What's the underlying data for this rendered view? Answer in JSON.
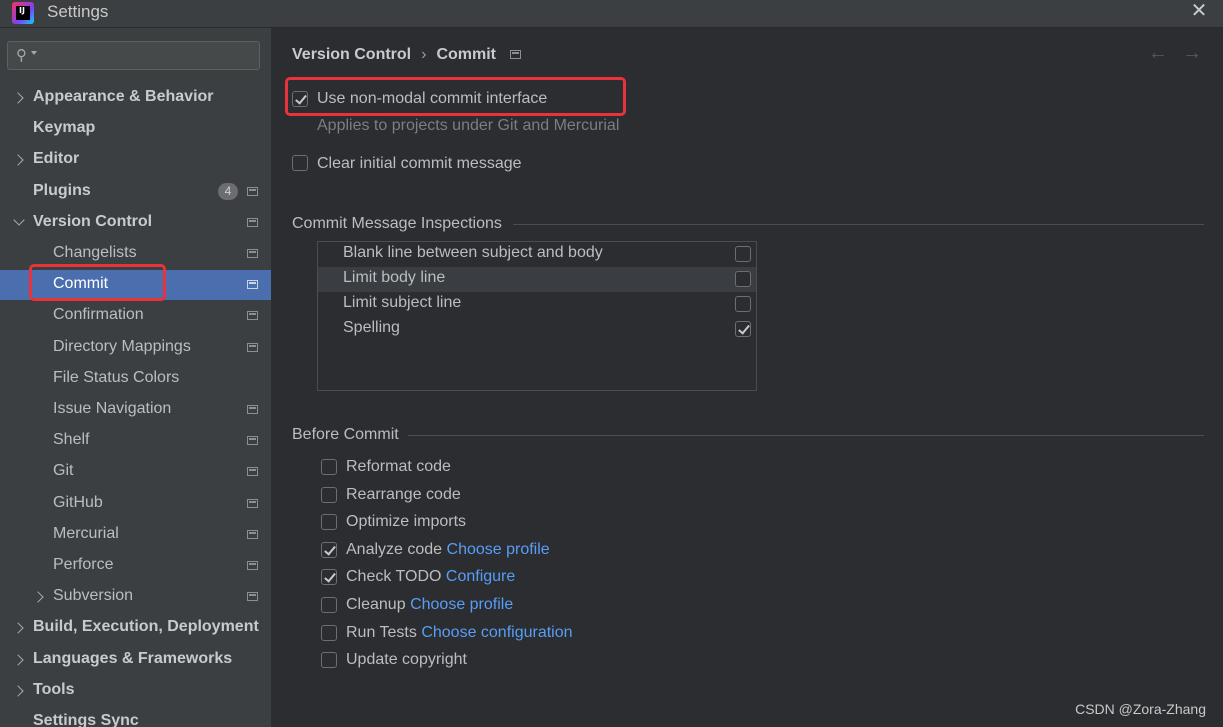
{
  "window": {
    "title": "Settings"
  },
  "search": {
    "placeholder": ""
  },
  "sidebar": {
    "items": [
      {
        "label": "Appearance & Behavior",
        "bold": true,
        "chevron": "right",
        "level": 0
      },
      {
        "label": "Keymap",
        "bold": true,
        "chevron": "",
        "level": 0
      },
      {
        "label": "Editor",
        "bold": true,
        "chevron": "right",
        "level": 0
      },
      {
        "label": "Plugins",
        "bold": true,
        "chevron": "",
        "level": 0,
        "badge": "4",
        "project_icon": true
      },
      {
        "label": "Version Control",
        "bold": true,
        "chevron": "down",
        "level": 0,
        "project_icon": true
      },
      {
        "label": "Changelists",
        "level": 1,
        "project_icon": true
      },
      {
        "label": "Commit",
        "level": 1,
        "project_icon": true,
        "selected": true
      },
      {
        "label": "Confirmation",
        "level": 1,
        "project_icon": true
      },
      {
        "label": "Directory Mappings",
        "level": 1,
        "project_icon": true
      },
      {
        "label": "File Status Colors",
        "level": 1
      },
      {
        "label": "Issue Navigation",
        "level": 1,
        "project_icon": true
      },
      {
        "label": "Shelf",
        "level": 1,
        "project_icon": true
      },
      {
        "label": "Git",
        "level": 1,
        "project_icon": true
      },
      {
        "label": "GitHub",
        "level": 1,
        "project_icon": true
      },
      {
        "label": "Mercurial",
        "level": 1,
        "project_icon": true
      },
      {
        "label": "Perforce",
        "level": 1,
        "project_icon": true
      },
      {
        "label": "Subversion",
        "level": 1,
        "chevron": "right",
        "project_icon": true
      },
      {
        "label": "Build, Execution, Deployment",
        "bold": true,
        "chevron": "right",
        "level": 0
      },
      {
        "label": "Languages & Frameworks",
        "bold": true,
        "chevron": "right",
        "level": 0
      },
      {
        "label": "Tools",
        "bold": true,
        "chevron": "right",
        "level": 0
      },
      {
        "label": "Settings Sync",
        "bold": true,
        "chevron": "",
        "level": 0
      }
    ]
  },
  "breadcrumb": {
    "parent": "Version Control",
    "separator": "›",
    "current": "Commit"
  },
  "nav": {
    "back": "←",
    "forward": "→"
  },
  "options": {
    "non_modal": {
      "label": "Use non-modal commit interface",
      "checked": true,
      "hint": "Applies to projects under Git and Mercurial"
    },
    "clear_message": {
      "label": "Clear initial commit message",
      "checked": false
    }
  },
  "inspections": {
    "title": "Commit Message Inspections",
    "rows": [
      {
        "label": "Blank line between subject and body",
        "checked": false
      },
      {
        "label": "Limit body line",
        "checked": false
      },
      {
        "label": "Limit subject line",
        "checked": false
      },
      {
        "label": "Spelling",
        "checked": true
      }
    ]
  },
  "before_commit": {
    "title": "Before Commit",
    "items": [
      {
        "label": "Reformat code",
        "checked": false,
        "link": ""
      },
      {
        "label": "Rearrange code",
        "checked": false,
        "link": ""
      },
      {
        "label": "Optimize imports",
        "checked": false,
        "link": ""
      },
      {
        "label": "Analyze code",
        "checked": true,
        "link": "Choose profile"
      },
      {
        "label": "Check TODO",
        "checked": true,
        "link": "Configure"
      },
      {
        "label": "Cleanup",
        "checked": false,
        "link": "Choose profile"
      },
      {
        "label": "Run Tests",
        "checked": false,
        "link": "Choose configuration"
      },
      {
        "label": "Update copyright",
        "checked": false,
        "link": ""
      }
    ]
  },
  "watermark": "CSDN @Zora-Zhang",
  "colors": {
    "selection": "#4b6eaf",
    "link": "#589df6",
    "highlight_box": "#e8333c"
  }
}
